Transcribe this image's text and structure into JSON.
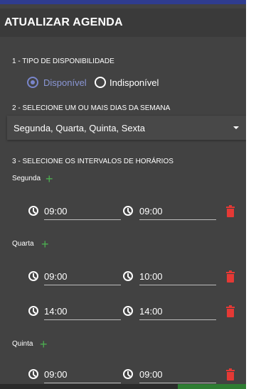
{
  "dialog": {
    "title": "ATUALIZAR AGENDA"
  },
  "availability": {
    "section_label": "1 - TIPO DE DISPONIBILIDADE",
    "options": [
      {
        "label": "Disponível",
        "selected": true
      },
      {
        "label": "Indisponível",
        "selected": false
      }
    ]
  },
  "weekdays": {
    "section_label": "2 - SELECIONE UM OU MAIS DIAS DA SEMANA",
    "selected_value": "Segunda, Quarta, Quinta, Sexta"
  },
  "intervals": {
    "section_label": "3 - SELECIONE OS INTERVALOS DE HORÁRIOS",
    "days": [
      {
        "name": "Segunda",
        "rows": [
          {
            "start": "09:00",
            "end": "09:00"
          }
        ]
      },
      {
        "name": "Quarta",
        "rows": [
          {
            "start": "09:00",
            "end": "10:00"
          },
          {
            "start": "14:00",
            "end": "14:00"
          }
        ]
      },
      {
        "name": "Quinta",
        "rows": [
          {
            "start": "09:00",
            "end": "09:00"
          }
        ]
      }
    ]
  },
  "icons": {
    "clock": "clock-icon",
    "add": "plus-icon",
    "delete": "trash-icon"
  },
  "colors": {
    "accent": "#7986cb",
    "add": "#4caf50",
    "delete": "#e53935",
    "panel": "#424242"
  }
}
